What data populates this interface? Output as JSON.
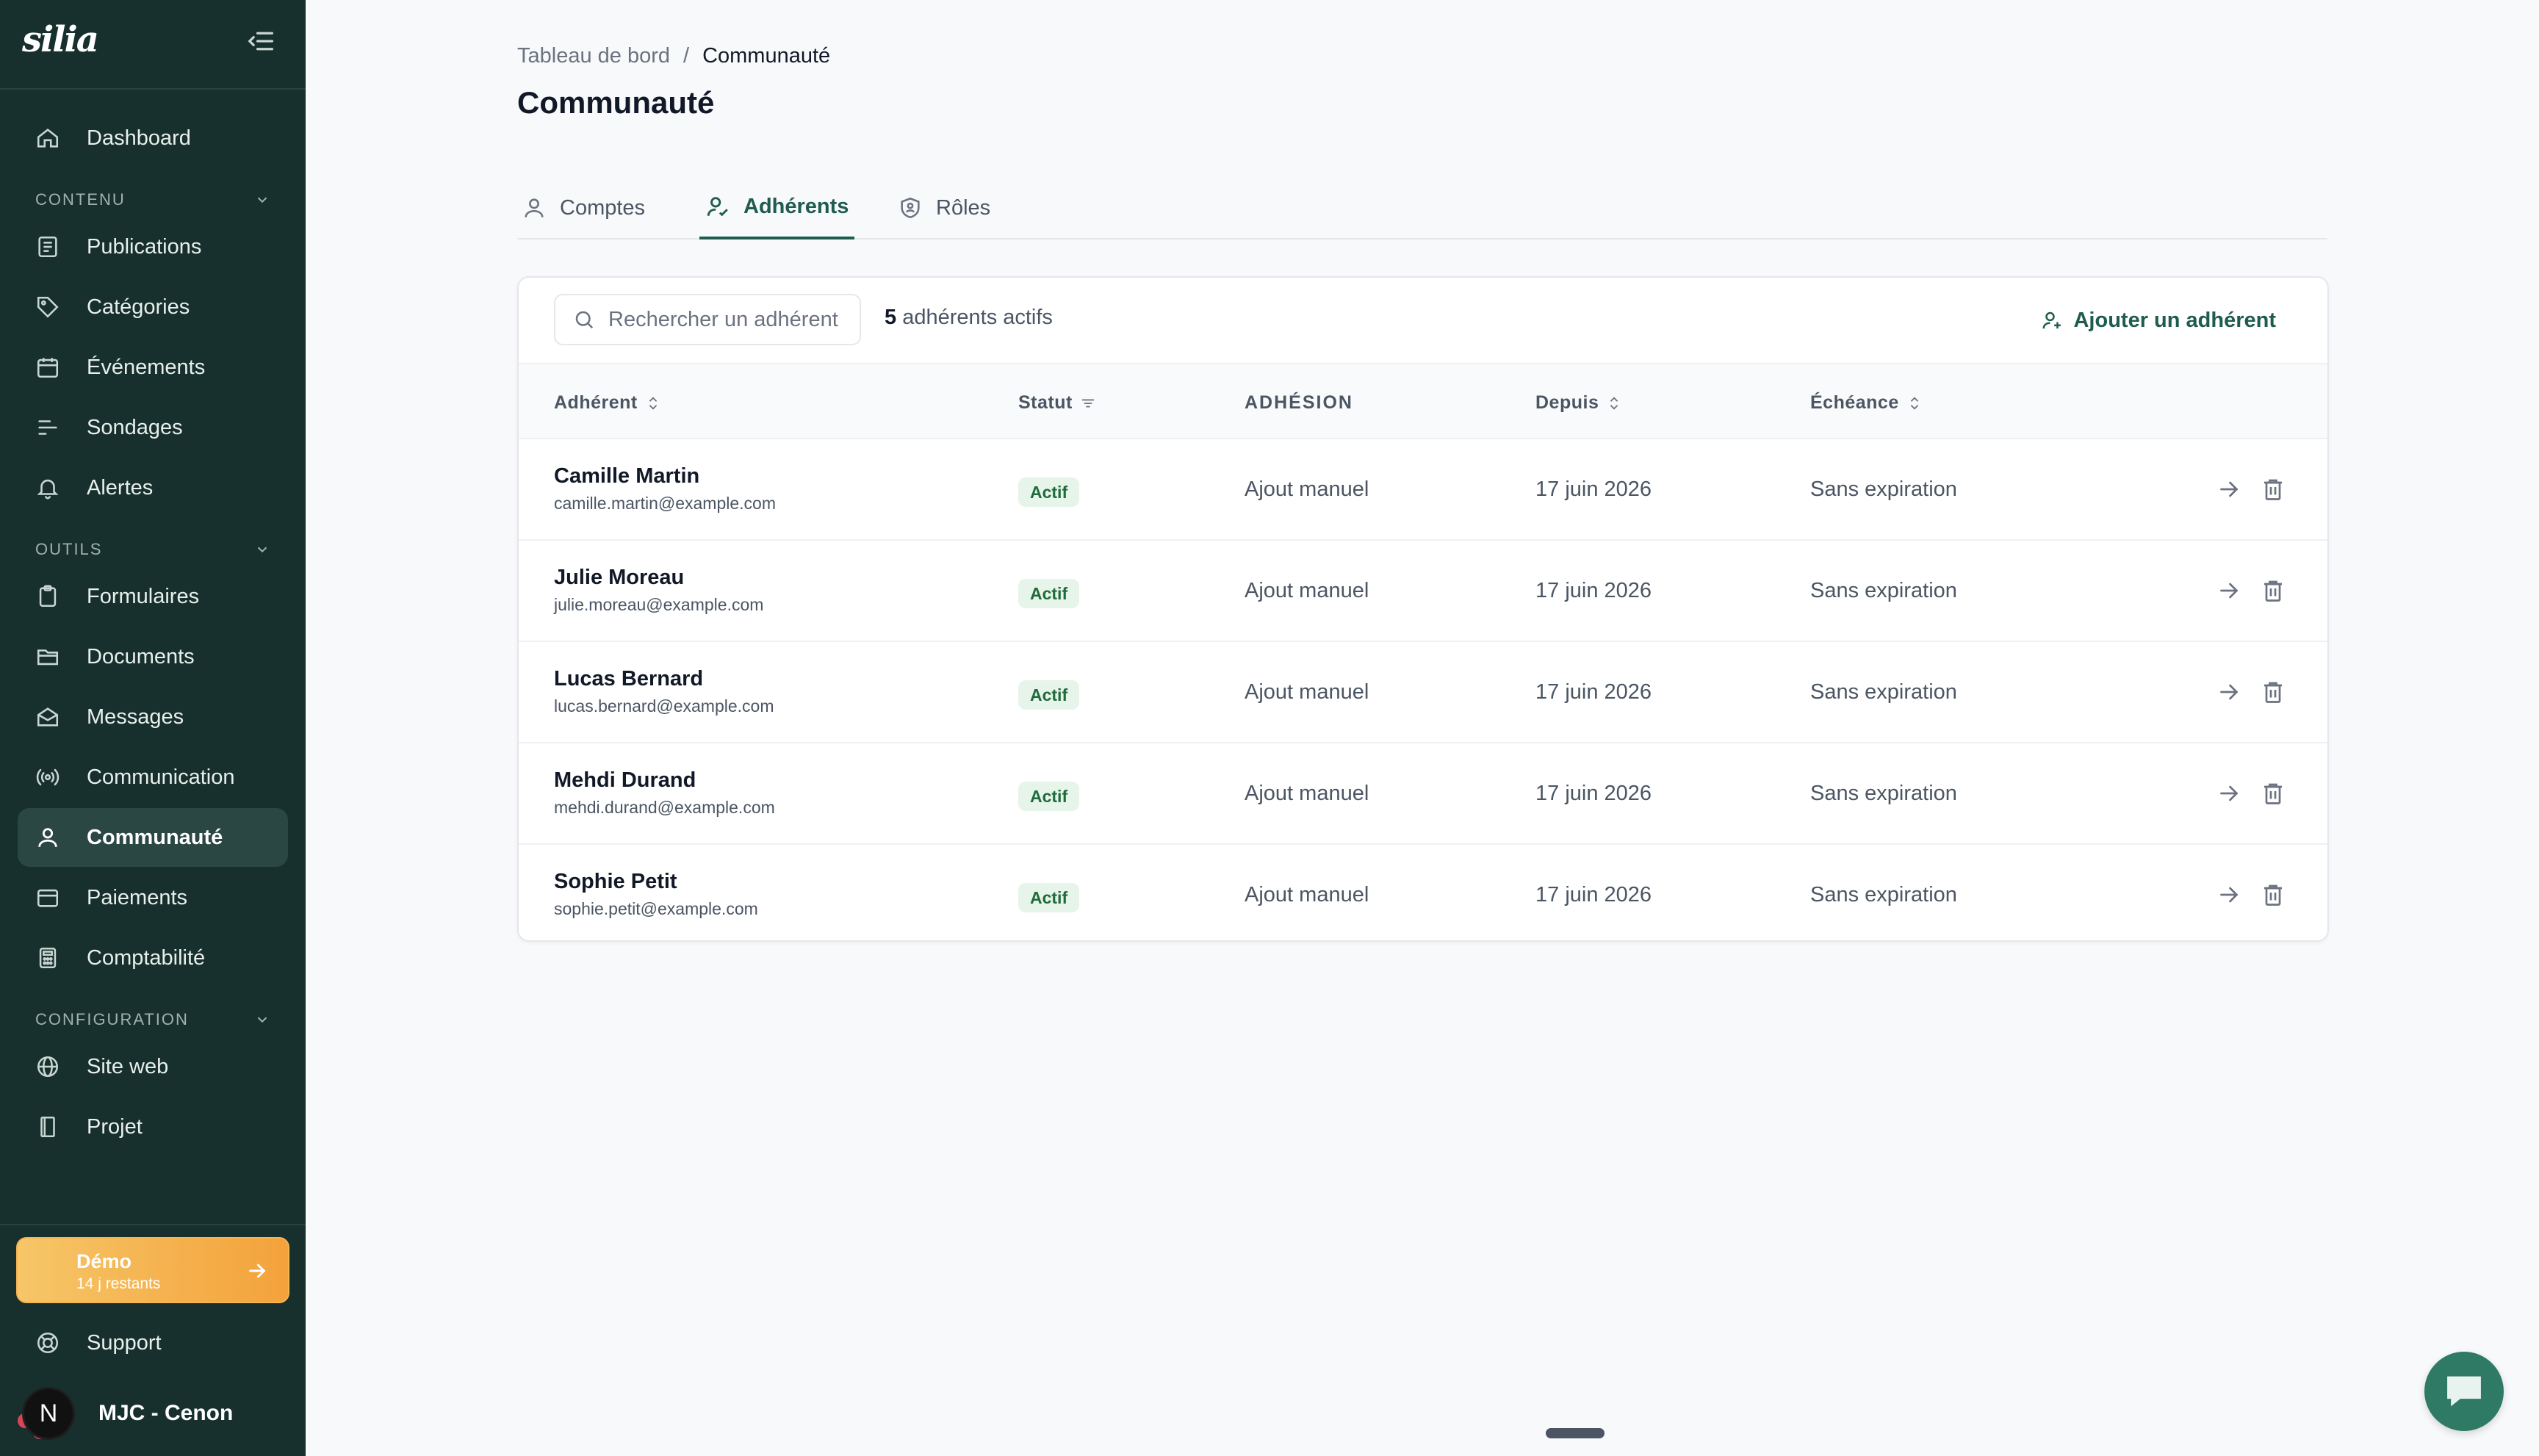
{
  "sidebar": {
    "logo": "silia",
    "items": {
      "dashboard": "Dashboard",
      "publications": "Publications",
      "categories": "Catégories",
      "evenements": "Événements",
      "sondages": "Sondages",
      "alertes": "Alertes",
      "formulaires": "Formulaires",
      "documents": "Documents",
      "messages": "Messages",
      "communication": "Communication",
      "communaute": "Communauté",
      "paiements": "Paiements",
      "comptabilite": "Comptabilité",
      "site_web": "Site web",
      "projet": "Projet",
      "support": "Support"
    },
    "sections": {
      "contenu": "CONTENU",
      "outils": "OUTILS",
      "configuration": "CONFIGURATION"
    },
    "demo": {
      "title": "Démo",
      "subtitle": "14 j restants"
    },
    "user": {
      "initial": "N",
      "name": "MJC - Cenon"
    }
  },
  "breadcrumb": {
    "parent": "Tableau de bord",
    "separator": "/",
    "current": "Communauté"
  },
  "page_title": "Communauté",
  "tabs": {
    "comptes": "Comptes",
    "adherents": "Adhérents",
    "roles": "Rôles"
  },
  "toolbar": {
    "search_placeholder": "Rechercher un adhérent",
    "count_number": "5",
    "count_label": "adhérents actifs",
    "add_label": "Ajouter un adhérent"
  },
  "table": {
    "headers": {
      "adherent": "Adhérent",
      "statut": "Statut",
      "adhesion": "ADHÉSION",
      "depuis": "Depuis",
      "echeance": "Échéance"
    },
    "rows": [
      {
        "name": "Camille Martin",
        "email": "camille.martin@example.com",
        "status": "Actif",
        "adhesion": "Ajout manuel",
        "since": "17 juin 2026",
        "expiry": "Sans expiration"
      },
      {
        "name": "Julie Moreau",
        "email": "julie.moreau@example.com",
        "status": "Actif",
        "adhesion": "Ajout manuel",
        "since": "17 juin 2026",
        "expiry": "Sans expiration"
      },
      {
        "name": "Lucas Bernard",
        "email": "lucas.bernard@example.com",
        "status": "Actif",
        "adhesion": "Ajout manuel",
        "since": "17 juin 2026",
        "expiry": "Sans expiration"
      },
      {
        "name": "Mehdi Durand",
        "email": "mehdi.durand@example.com",
        "status": "Actif",
        "adhesion": "Ajout manuel",
        "since": "17 juin 2026",
        "expiry": "Sans expiration"
      },
      {
        "name": "Sophie Petit",
        "email": "sophie.petit@example.com",
        "status": "Actif",
        "adhesion": "Ajout manuel",
        "since": "17 juin 2026",
        "expiry": "Sans expiration"
      }
    ]
  },
  "colors": {
    "sidebar_bg": "#17302d",
    "accent": "#1f5c4f",
    "badge_bg": "#e6f4ea",
    "badge_text": "#1f6b3a",
    "demo_gradient": [
      "#f6c668",
      "#f4a23b"
    ],
    "chat_button": "#2f7a64"
  },
  "icons": {
    "collapse": "sidebar-collapse-icon",
    "dashboard": "home-icon",
    "publications": "newspaper-icon",
    "categories": "tag-icon",
    "evenements": "calendar-icon",
    "sondages": "poll-icon",
    "alertes": "bell-icon",
    "formulaires": "clipboard-icon",
    "documents": "folder-icon",
    "messages": "mail-open-icon",
    "communication": "broadcast-icon",
    "communaute": "user-icon",
    "paiements": "wallet-icon",
    "comptabilite": "calculator-icon",
    "site_web": "globe-icon",
    "projet": "book-icon",
    "support": "lifebuoy-icon",
    "search": "search-icon",
    "add": "user-plus-icon",
    "sort": "sort-icon",
    "filter": "filter-icon",
    "row_open": "arrow-right-icon",
    "row_delete": "trash-icon",
    "chat": "chat-icon"
  }
}
